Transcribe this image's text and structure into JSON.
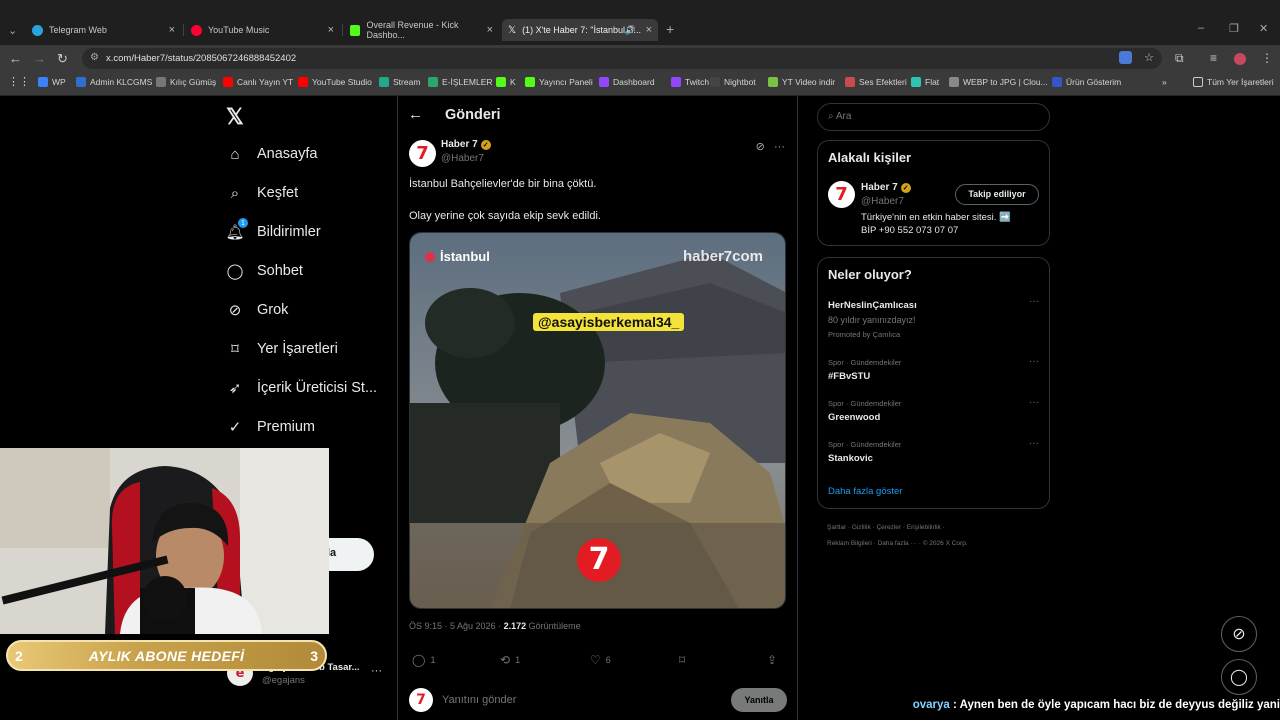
{
  "browser": {
    "tabs": [
      {
        "title": "Telegram Web",
        "color": "#2aa3df"
      },
      {
        "title": "YouTube Music",
        "color": "#ff0000"
      },
      {
        "title": "Overall Revenue - Kick Dashbo...",
        "color": "#53fc18"
      },
      {
        "title": "(1) X'te Haber 7: \"İstanbul B...",
        "color": "#e7e9ea"
      }
    ],
    "url": "x.com/Haber7/status/2085067246888452402",
    "bookmarks": [
      "WP",
      "Admin KLCGMS",
      "Kılıç Gümüş",
      "Canlı Yayın YT",
      "YouTube Studio",
      "Stream",
      "E-İŞLEMLER",
      "K",
      "Yayıncı Paneli",
      "Dashboard",
      "Twitch",
      "Nightbot",
      "YT Video indir",
      "Ses Efektleri",
      "Flat",
      "WEBP to JPG | Clou...",
      "Ürün Gösterim"
    ],
    "bookmarks_folder": "Tüm Yer İşaretleri"
  },
  "nav": {
    "items": [
      "Anasayfa",
      "Keşfet",
      "Bildirimler",
      "Sohbet",
      "Grok",
      "Yer İşaretleri",
      "İçerik Üreticisi St...",
      "Premium"
    ],
    "notif_badge": "1",
    "post_button_partial": "la"
  },
  "post": {
    "header": "Gönderi",
    "author_name": "Haber 7",
    "author_handle": "@Haber7",
    "text1": "İstanbul Bahçelievler'de bir bina çöktü.",
    "text2": "Olay yerine çok sayıda ekip sevk edildi.",
    "media_location": "İstanbul",
    "media_brand": "haber7com",
    "media_tag": "@asayisberkemal34_",
    "time": "ÖS 9:15 · 5 Ağu 2026 · ",
    "views": "2.172",
    "views_label": " Görüntüleme",
    "replies": "1",
    "reposts": "1",
    "likes": "6",
    "reply_placeholder": "Yanıtını gönder",
    "reply_button": "Yanıtla"
  },
  "sidebar": {
    "search_placeholder": "Ara",
    "related_title": "Alakalı kişiler",
    "related_name": "Haber 7",
    "related_handle": "@Haber7",
    "follow_label": "Takip ediliyor",
    "bio1": "Türkiye'nin en etkin haber sitesi. ➡️",
    "bio2": "BİP +90 552 073 07 07",
    "trends_title": "Neler oluyor?",
    "promo_name": "HerNeslinÇamlıcası",
    "promo_sub": "80 yıldır yanınızdayız!",
    "promo_by": "Promoted by Çamlıca",
    "trends": [
      {
        "cat": "Spor · Gündemdekiler",
        "name": "#FBvSTU"
      },
      {
        "cat": "Spor · Gündemdekiler",
        "name": "Greenwood"
      },
      {
        "cat": "Spor · Gündemdekiler",
        "name": "Stankovic"
      }
    ],
    "show_more": "Daha fazla göster",
    "footer1": "Şartlar · Gizlilik · Çerezler · Erişilebilirlik ·",
    "footer2": "Reklam Bilgileri · Daha fazla ··· · © 2026 X Corp."
  },
  "overlay": {
    "abone_title": "AYLIK ABONE HEDEFİ",
    "abone_current": "2",
    "abone_goal": "3",
    "account_name": "Eg Ajans Web Tasar...",
    "account_handle": "@egajans",
    "ticker_user": "ovarya",
    "ticker_msg": " : Aynen ben de öyle yapıcam hacı biz de deyyus değiliz yani"
  }
}
